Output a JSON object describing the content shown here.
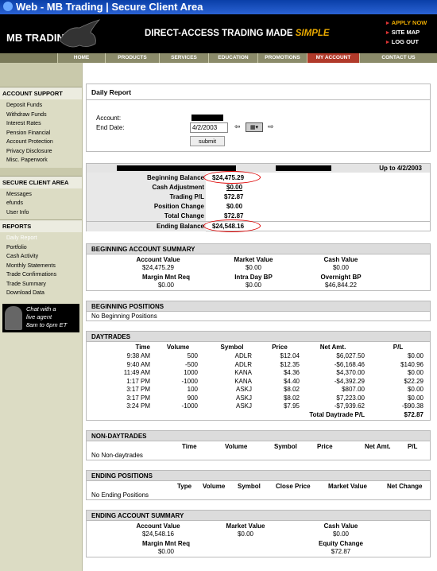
{
  "window": {
    "title": "Web - MB Trading | Secure Client Area"
  },
  "header": {
    "logo": "MB TRADING",
    "tagline_main": "DIRECT-ACCESS TRADING MADE ",
    "tagline_emph": "SIMPLE",
    "links": [
      "APPLY NOW",
      "SITE MAP",
      "LOG OUT"
    ]
  },
  "nav": [
    "HOME",
    "PRODUCTS",
    "SERVICES",
    "EDUCATION",
    "PROMOTIONS",
    "MY ACCOUNT",
    "CONTACT US"
  ],
  "sidebar": {
    "account_support": {
      "title": "ACCOUNT SUPPORT",
      "items": [
        "Deposit Funds",
        "Withdraw Funds",
        "Interest Rates",
        "Pension Financial",
        "Account Protection",
        "Privacy Disclosure",
        "Misc. Paperwork"
      ]
    },
    "secure": {
      "title": "SECURE CLIENT AREA",
      "items": [
        "Messages",
        "efunds",
        "User Info"
      ]
    },
    "reports": {
      "title": "REPORTS",
      "items": [
        "Daily Report",
        "Portfolio",
        "Cash Activity",
        "Monthly Statements",
        "Trade Confirmations",
        "Trade Summary",
        "Download Data"
      ]
    },
    "chat": {
      "line1": "Chat with a",
      "line2": "live agent",
      "line3": "8am to 6pm ET"
    }
  },
  "report": {
    "title": "Daily Report",
    "account_label": "Account:",
    "end_date_label": "End Date:",
    "end_date_value": "4/2/2003",
    "submit": "submit",
    "up_to": "Up to 4/2/2003"
  },
  "balances": [
    {
      "label": "Beginning Balance",
      "value": "$24,475.29"
    },
    {
      "label": "Cash Adjustment",
      "value": "$0.00"
    },
    {
      "label": "Trading P/L",
      "value": "$72.87"
    },
    {
      "label": "Position Change",
      "value": "$0.00"
    },
    {
      "label": "Total Change",
      "value": "$72.87"
    },
    {
      "label": "Ending Balance",
      "value": "$24,548.16"
    }
  ],
  "beginning_summary": {
    "title": "BEGINNING ACCOUNT SUMMARY",
    "h1": "Account Value",
    "v1": "$24,475.29",
    "h2": "Market Value",
    "v2": "$0.00",
    "h3": "Cash Value",
    "v3": "$0.00",
    "h4": "Margin Mnt Req",
    "v4": "$0.00",
    "h5": "Intra Day BP",
    "v5": "$0.00",
    "h6": "Overnight BP",
    "v6": "$46,844.22"
  },
  "beginning_positions": {
    "title": "BEGINNING POSITIONS",
    "empty": "No Beginning Positions"
  },
  "daytrades": {
    "title": "DAYTRADES",
    "columns": [
      "Time",
      "Volume",
      "Symbol",
      "Price",
      "Net Amt.",
      "P/L"
    ],
    "rows": [
      [
        "9:38 AM",
        "500",
        "ADLR",
        "$12.04",
        "$6,027.50",
        "$0.00"
      ],
      [
        "9:40 AM",
        "-500",
        "ADLR",
        "$12.35",
        "-$6,168.46",
        "$140.96"
      ],
      [
        "11:49 AM",
        "1000",
        "KANA",
        "$4.36",
        "$4,370.00",
        "$0.00"
      ],
      [
        "1:17 PM",
        "-1000",
        "KANA",
        "$4.40",
        "-$4,392.29",
        "$22.29"
      ],
      [
        "3:17 PM",
        "100",
        "ASKJ",
        "$8.02",
        "$807.00",
        "$0.00"
      ],
      [
        "3:17 PM",
        "900",
        "ASKJ",
        "$8.02",
        "$7,223.00",
        "$0.00"
      ],
      [
        "3:24 PM",
        "-1000",
        "ASKJ",
        "$7.95",
        "-$7,939.62",
        "-$90.38"
      ]
    ],
    "total_label": "Total Daytrade P/L",
    "total_value": "$72.87"
  },
  "non_daytrades": {
    "title": "NON-DAYTRADES",
    "columns": [
      "Time",
      "Volume",
      "Symbol",
      "Price",
      "Net Amt.",
      "P/L"
    ],
    "empty": "No Non-daytrades"
  },
  "ending_positions": {
    "title": "ENDING POSITIONS",
    "columns": [
      "Type",
      "Volume",
      "Symbol",
      "Close Price",
      "Market Value",
      "Net Change"
    ],
    "empty": "No Ending Positions"
  },
  "ending_summary": {
    "title": "ENDING ACCOUNT SUMMARY",
    "h1": "Account Value",
    "v1": "$24,548.16",
    "h2": "Market Value",
    "v2": "$0.00",
    "h3": "Cash Value",
    "v3": "$0.00",
    "h4": "Margin Mnt Req",
    "v4": "$0.00",
    "h5": "Equity Change",
    "v5": "$72.87"
  },
  "colors": {
    "accent": "#e8a800",
    "nav_active": "#b13a2a",
    "sidebar_bg": "#dcdcc4"
  }
}
